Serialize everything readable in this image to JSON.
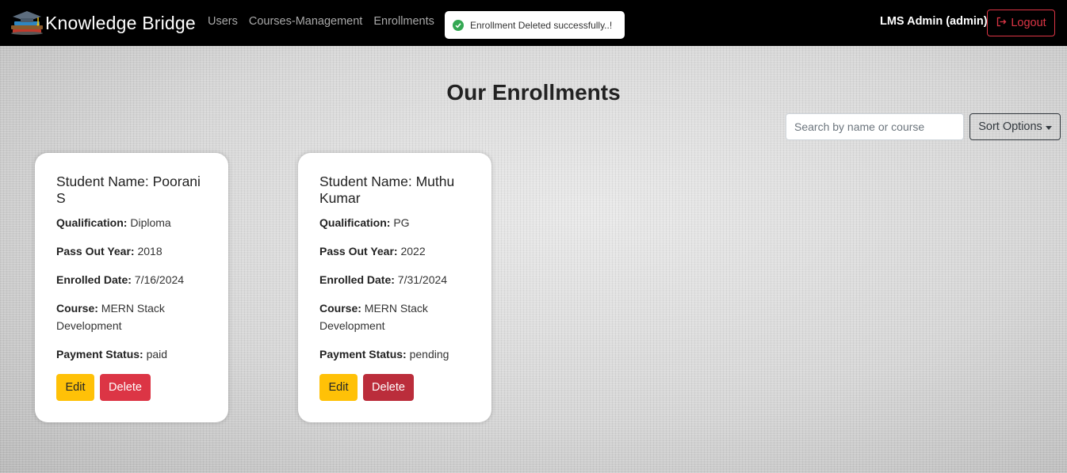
{
  "navbar": {
    "brand_title": "Knowledge Bridge",
    "brand_logo_icon": "graduation-cap-books-icon",
    "links": [
      "Users",
      "Courses-Management",
      "Enrollments"
    ],
    "user_label": "LMS Admin (admin)",
    "logout_label": "Logout",
    "logout_icon": "logout-icon"
  },
  "toast": {
    "message": "Enrollment Deleted successfully..!",
    "icon": "check-circle-icon",
    "color": "#34a853"
  },
  "page": {
    "title": "Our Enrollments",
    "search_placeholder": "Search by name or course",
    "sort_label": "Sort Options"
  },
  "labels": {
    "student_name": "Student Name:",
    "qualification": "Qualification:",
    "pass_out_year": "Pass Out Year:",
    "enrolled_date": "Enrolled Date:",
    "course": "Course:",
    "payment_status": "Payment Status:",
    "edit": "Edit",
    "delete": "Delete"
  },
  "enrollments": [
    {
      "student_name": "Poorani S",
      "qualification": "Diploma",
      "pass_out_year": "2018",
      "enrolled_date": "7/16/2024",
      "course": "MERN Stack Development",
      "payment_status": "paid"
    },
    {
      "student_name": "Muthu Kumar",
      "qualification": "PG",
      "pass_out_year": "2022",
      "enrolled_date": "7/31/2024",
      "course": "MERN Stack Development",
      "payment_status": "pending"
    }
  ],
  "colors": {
    "navbar_bg": "#000000",
    "edit_button": "#ffc107",
    "delete_button": "#dc3545",
    "logout_outline": "#dc3545"
  }
}
